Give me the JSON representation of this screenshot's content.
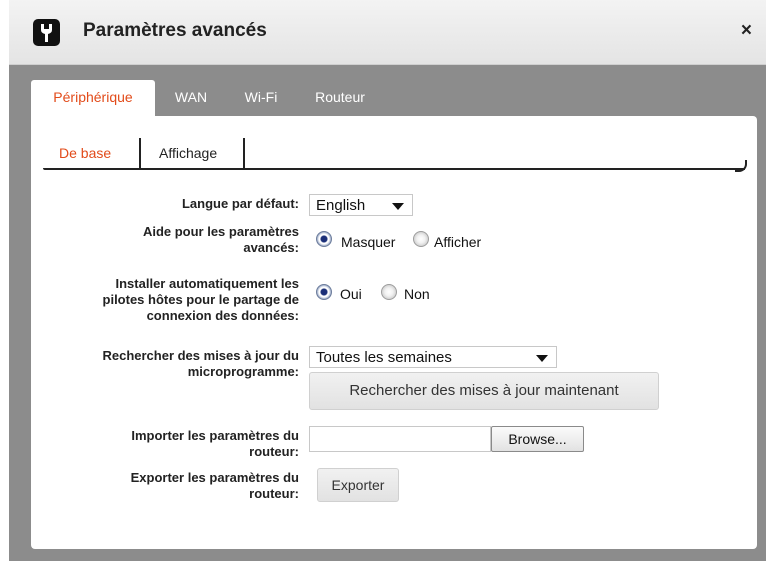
{
  "dialog": {
    "title": "Paramètres avancés",
    "close_label": "×"
  },
  "tabs": [
    {
      "label": "Périphérique",
      "active": true
    },
    {
      "label": "WAN",
      "active": false
    },
    {
      "label": "Wi-Fi",
      "active": false
    },
    {
      "label": "Routeur",
      "active": false
    }
  ],
  "subtabs": [
    {
      "label": "De base",
      "active": true
    },
    {
      "label": "Affichage",
      "active": false
    }
  ],
  "form": {
    "language": {
      "label": "Langue par défaut:",
      "value": "English"
    },
    "help": {
      "label_line1": "Aide pour les paramètres",
      "label_line2": "avancés:",
      "option_on": "Masquer",
      "option_off": "Afficher"
    },
    "drivers": {
      "label_line1": "Installer automatiquement les",
      "label_line2": "pilotes hôtes pour le partage de",
      "label_line3": "connexion des données:",
      "option_on": "Oui",
      "option_off": "Non"
    },
    "updates": {
      "label_line1": "Rechercher des mises à jour du",
      "label_line2": "microprogramme:",
      "value": "Toutes les semaines",
      "check_button": "Rechercher des mises à jour maintenant"
    },
    "import": {
      "label_line1": "Importer les paramètres du",
      "label_line2": "routeur:",
      "file_value": "",
      "browse_button": "Browse..."
    },
    "export": {
      "label_line1": "Exporter les paramètres du",
      "label_line2": "routeur:",
      "export_button": "Exporter"
    }
  },
  "colors": {
    "accent": "#e24b1a",
    "overlay": "#8c8c8c"
  },
  "icons": {
    "title": "wrench-icon",
    "close": "close-icon"
  }
}
